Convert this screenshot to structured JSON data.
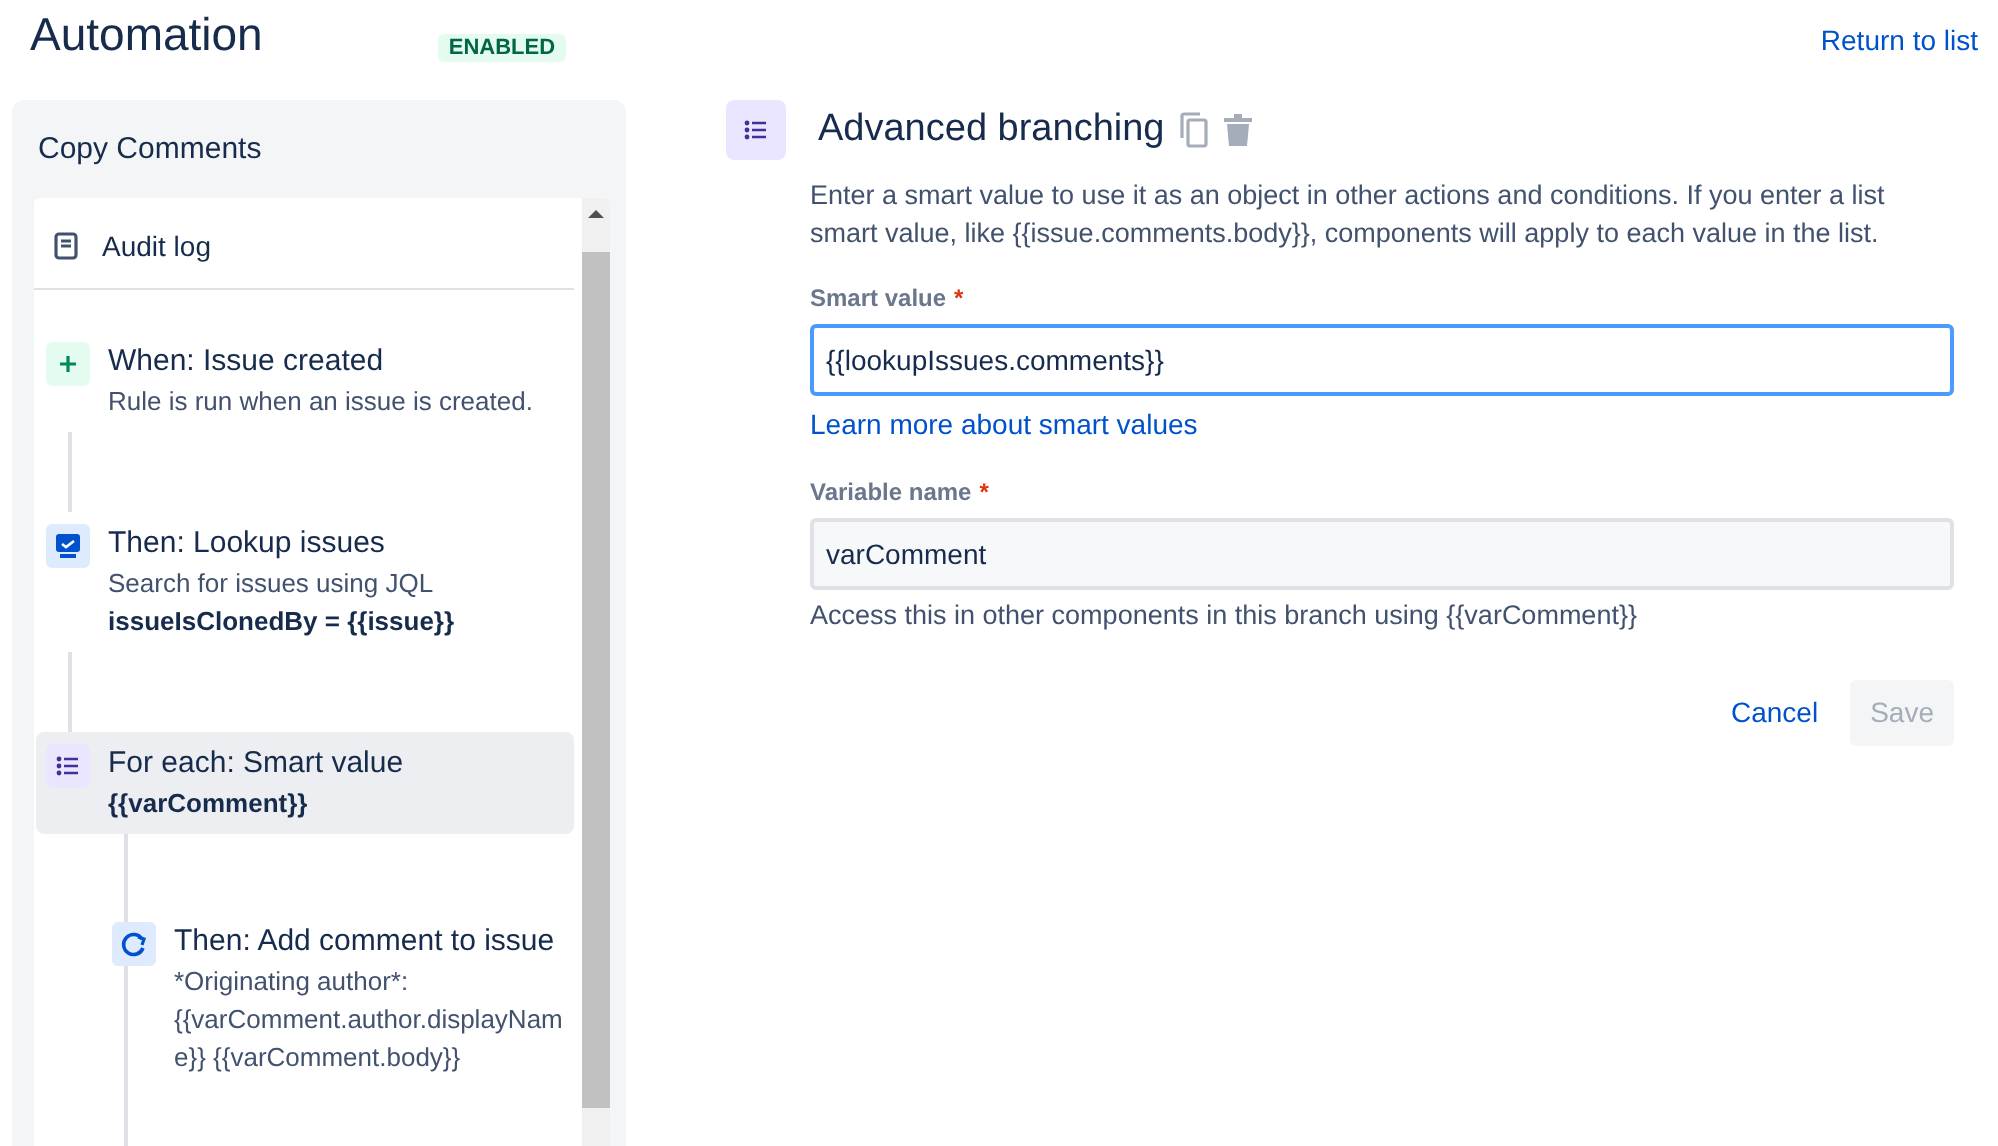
{
  "header": {
    "title": "Automation",
    "status_badge": "ENABLED",
    "return_link": "Return to list"
  },
  "rule_panel": {
    "rule_name": "Copy Comments",
    "menu_items": [
      {
        "label": "Audit log",
        "kind": "audit"
      }
    ],
    "steps": [
      {
        "kind": "trigger",
        "title": "When: Issue created",
        "description": "Rule is run when an issue is created.",
        "selected": false
      },
      {
        "kind": "action",
        "title": "Then: Lookup issues",
        "description": "Search for issues using JQL",
        "detail": "issueIsClonedBy = {{issue}}",
        "selected": false
      },
      {
        "kind": "branch",
        "title": "For each: Smart value",
        "detail": "{{varComment}}",
        "selected": true,
        "children": [
          {
            "kind": "comment",
            "title": "Then: Add comment to issue",
            "description": "*Originating author*: {{varComment.author.displayName}} {{varComment.body}}",
            "selected": false
          }
        ]
      }
    ]
  },
  "editor": {
    "title": "Advanced branching",
    "intro": "Enter a smart value to use it as an object in other actions and conditions. If you enter a list smart value, like {{issue.comments.body}}, components will apply to each value in the list.",
    "fields": [
      {
        "label": "Smart value",
        "required_mark": "*",
        "value": "{{lookupIssues.comments}}",
        "focused": true,
        "link": "Learn more about smart values"
      },
      {
        "label": "Variable name",
        "required_mark": "*",
        "value": "varComment",
        "focused": false,
        "help": "Access this in other components in this branch using {{varComment}}"
      }
    ],
    "buttons": [
      {
        "label": "Cancel",
        "kind": "link",
        "disabled": false
      },
      {
        "label": "Save",
        "kind": "primary",
        "disabled": true
      }
    ]
  }
}
